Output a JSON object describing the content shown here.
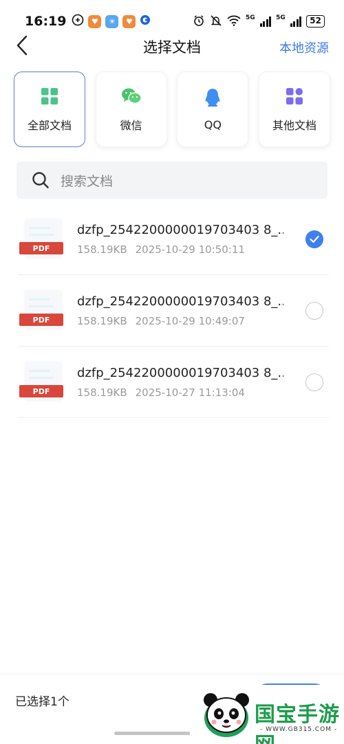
{
  "status_bar": {
    "time": "16:19",
    "net_5g_a": "5G",
    "net_5g_b": "5G",
    "battery": "52"
  },
  "header": {
    "title": "选择文档",
    "right_link": "本地资源"
  },
  "categories": [
    {
      "label": "全部文档",
      "icon": "grid-icon",
      "selected": true,
      "color": "#4cc38a"
    },
    {
      "label": "微信",
      "icon": "wechat-icon",
      "selected": false,
      "color": "#4cc36a"
    },
    {
      "label": "QQ",
      "icon": "qq-penguin-icon",
      "selected": false,
      "color": "#3f8ff0"
    },
    {
      "label": "其他文档",
      "icon": "apps-icon",
      "selected": false,
      "color": "#7b6cf0"
    }
  ],
  "search": {
    "placeholder": "搜索文档"
  },
  "files": [
    {
      "name": "dzfp_2542200000019703403 8_...",
      "size": "158.19KB",
      "date": "2025-10-29 10:50:11",
      "type": "PDF",
      "checked": true
    },
    {
      "name": "dzfp_2542200000019703403 8_...",
      "size": "158.19KB",
      "date": "2025-10-29 10:49:07",
      "type": "PDF",
      "checked": false
    },
    {
      "name": "dzfp_2542200000019703403 8_...",
      "size": "158.19KB",
      "date": "2025-10-27 11:13:04",
      "type": "PDF",
      "checked": false
    }
  ],
  "footer": {
    "selected_text": "已选择1个"
  },
  "watermark": {
    "title": "国宝手游网",
    "url": "- WWW.GB315.COM -"
  },
  "colors": {
    "accent": "#3f7ff0",
    "pdf_tag": "#d9463b",
    "link": "#3b7be6"
  }
}
